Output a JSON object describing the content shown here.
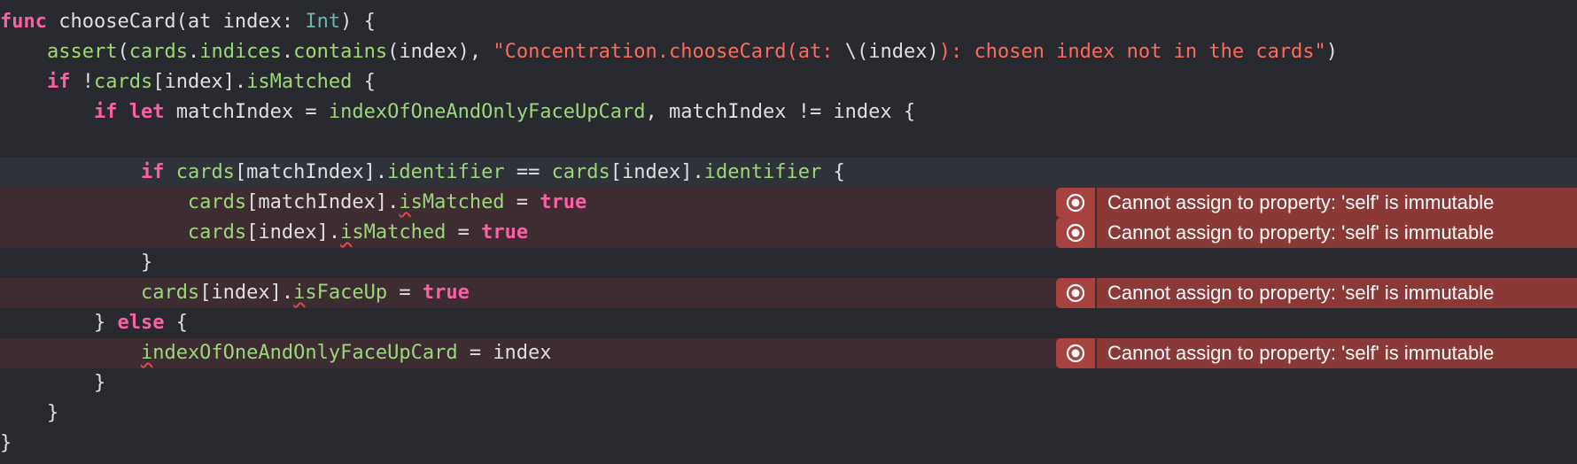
{
  "editor": {
    "lines": [
      [
        [
          "kw",
          "func"
        ],
        [
          "pl",
          " chooseCard(at index: "
        ],
        [
          "ty",
          "Int"
        ],
        [
          "pl",
          ") {"
        ]
      ],
      [
        [
          "pl",
          "    "
        ],
        [
          "fn",
          "assert"
        ],
        [
          "pl",
          "("
        ],
        [
          "mt",
          "cards"
        ],
        [
          "pl",
          "."
        ],
        [
          "mt",
          "indices"
        ],
        [
          "pl",
          "."
        ],
        [
          "fn",
          "contains"
        ],
        [
          "pl",
          "(index), "
        ],
        [
          "st",
          "\"Concentration.chooseCard(at: "
        ],
        [
          "pl",
          "\\("
        ],
        [
          "pl",
          "index"
        ],
        [
          "pl",
          ")"
        ],
        [
          "st",
          "): chosen index not in the cards\""
        ],
        [
          "pl",
          ")"
        ]
      ],
      [
        [
          "pl",
          "    "
        ],
        [
          "kw",
          "if"
        ],
        [
          "pl",
          " !"
        ],
        [
          "mt",
          "cards"
        ],
        [
          "pl",
          "[index]."
        ],
        [
          "mt",
          "isMatched"
        ],
        [
          "pl",
          " {"
        ]
      ],
      [
        [
          "pl",
          "        "
        ],
        [
          "kw",
          "if let"
        ],
        [
          "pl",
          " matchIndex = "
        ],
        [
          "mt",
          "indexOfOneAndOnlyFaceUpCard"
        ],
        [
          "pl",
          ", matchIndex != index {"
        ]
      ],
      [
        [
          "pl",
          ""
        ]
      ],
      [
        [
          "pl",
          "            "
        ],
        [
          "kw",
          "if"
        ],
        [
          "pl",
          " "
        ],
        [
          "mt",
          "cards"
        ],
        [
          "pl",
          "[matchIndex]."
        ],
        [
          "mt",
          "identifier"
        ],
        [
          "pl",
          " == "
        ],
        [
          "mt",
          "cards"
        ],
        [
          "pl",
          "[index]."
        ],
        [
          "mt",
          "identifier"
        ],
        [
          "pl",
          " {"
        ]
      ],
      [
        [
          "pl",
          "                "
        ],
        [
          "mt",
          "cards"
        ],
        [
          "pl",
          "[matchIndex]."
        ],
        [
          "sqmt",
          "i"
        ],
        [
          "mt",
          "sMatched"
        ],
        [
          "pl",
          " = "
        ],
        [
          "kw",
          "true"
        ]
      ],
      [
        [
          "pl",
          "                "
        ],
        [
          "mt",
          "cards"
        ],
        [
          "pl",
          "[index]."
        ],
        [
          "sqmt",
          "i"
        ],
        [
          "mt",
          "sMatched"
        ],
        [
          "pl",
          " = "
        ],
        [
          "kw",
          "true"
        ]
      ],
      [
        [
          "pl",
          "            }"
        ]
      ],
      [
        [
          "pl",
          "            "
        ],
        [
          "mt",
          "cards"
        ],
        [
          "pl",
          "[index]."
        ],
        [
          "sqmt",
          "i"
        ],
        [
          "mt",
          "sFaceUp"
        ],
        [
          "pl",
          " = "
        ],
        [
          "kw",
          "true"
        ]
      ],
      [
        [
          "pl",
          "        } "
        ],
        [
          "kw",
          "else"
        ],
        [
          "pl",
          " {"
        ]
      ],
      [
        [
          "pl",
          "            "
        ],
        [
          "sqmt",
          "i"
        ],
        [
          "mt",
          "ndexOfOneAndOnlyFaceUpCard"
        ],
        [
          "pl",
          " = index"
        ]
      ],
      [
        [
          "pl",
          "        }"
        ]
      ],
      [
        [
          "pl",
          "    }"
        ]
      ],
      [
        [
          "pl",
          "}"
        ]
      ]
    ],
    "error_lines": [
      6,
      7,
      9,
      11
    ],
    "current_line": 5
  },
  "issues": {
    "line6": "Cannot assign to property: 'self' is immutable",
    "line7": "Cannot assign to property: 'self' is immutable",
    "line9": "Cannot assign to property: 'self' is immutable",
    "line11": "Cannot assign to property: 'self' is immutable"
  },
  "colors": {
    "background": "#292a30",
    "keyword": "#fc5fa3",
    "type": "#67b7a4",
    "function": "#a2d96e",
    "member": "#9dd67a",
    "string": "#fc6a5d",
    "plain": "#dfdfe0",
    "error_line": "#3d2d32",
    "error_badge": "#8a3937",
    "error_icon_bg": "#a8423f"
  },
  "icons": {
    "issue": "error-circle-icon"
  }
}
